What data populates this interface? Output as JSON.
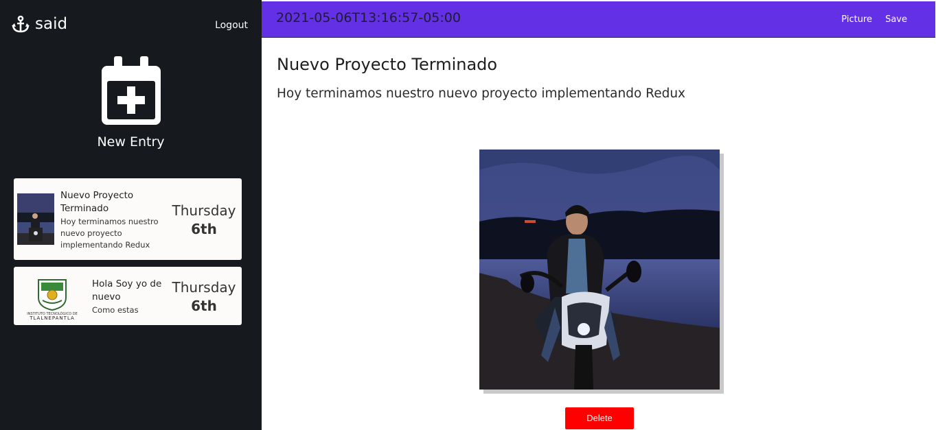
{
  "brand": {
    "name": "said",
    "icon": "anchor-icon"
  },
  "sidebar": {
    "logout_label": "Logout",
    "new_entry": {
      "label": "New Entry",
      "icon": "calendar-plus-icon"
    },
    "entries": [
      {
        "title": "Nuevo Proyecto Terminado",
        "text": "Hoy terminamos nuestro nuevo proyecto implementando Redux",
        "day": "Thursday",
        "date": "6th",
        "thumb": "motorcycle-photo"
      },
      {
        "title": "Hola Soy yo de nuevo",
        "text": "Como estas",
        "day": "Thursday",
        "date": "6th",
        "thumb": "institute-logo",
        "thumb_caption_small": "INSTITUTO TECNOLÓGICO DE",
        "thumb_caption": "TLALNEPANTLA"
      }
    ]
  },
  "topbar": {
    "date": "2021-05-06T13:16:57-05:00",
    "picture_label": "Picture",
    "save_label": "Save",
    "color": "#6330e6"
  },
  "entry": {
    "title": "Nuevo Proyecto Terminado",
    "body": "Hoy terminamos nuestro nuevo proyecto implementando Redux",
    "image": "motorcycle-photo"
  },
  "actions": {
    "delete_label": "Delete",
    "delete_color": "#ff0000"
  }
}
